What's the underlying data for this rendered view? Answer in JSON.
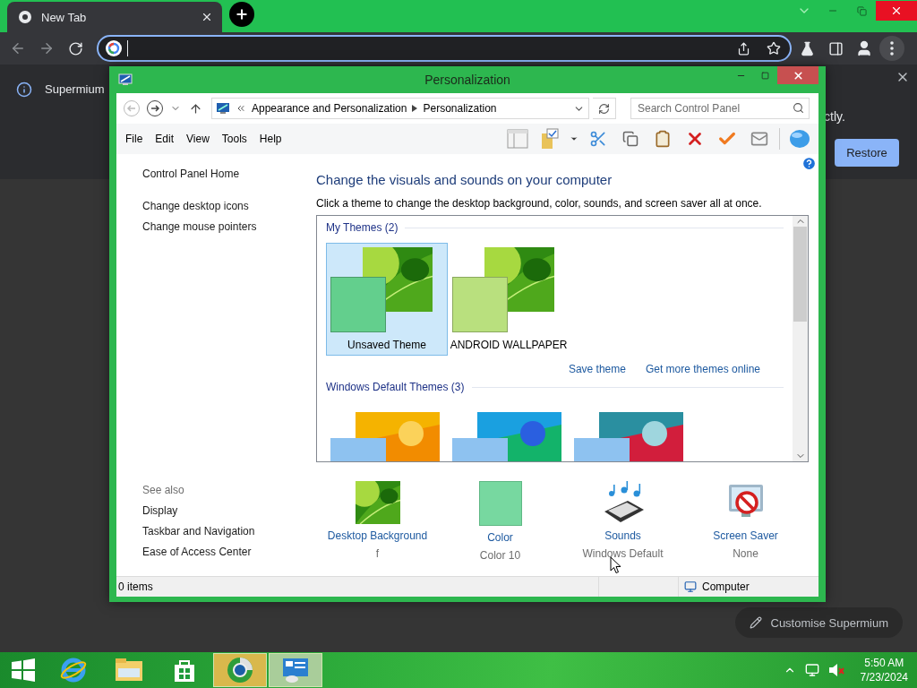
{
  "browser": {
    "tab": {
      "title": "New Tab"
    },
    "omnibox": {
      "focused": true
    },
    "infobar": {
      "title": "Supermium",
      "message": "ctly.",
      "button": "Restore"
    },
    "customise_button": "Customise Supermium"
  },
  "window": {
    "title": "Personalization",
    "breadcrumb": [
      "Appearance and Personalization",
      "Personalization"
    ],
    "search": {
      "placeholder": "Search Control Panel"
    },
    "menu": [
      "File",
      "Edit",
      "View",
      "Tools",
      "Help"
    ],
    "sidebar": {
      "links": [
        "Control Panel Home",
        "Change desktop icons",
        "Change mouse pointers"
      ],
      "see_also_title": "See also",
      "see_also": [
        "Display",
        "Taskbar and Navigation",
        "Ease of Access Center"
      ]
    },
    "heading": "Change the visuals and sounds on your computer",
    "subtitle": "Click a theme to change the desktop background, color, sounds, and screen saver all at once.",
    "theme_groups": [
      {
        "title": "My Themes (2)",
        "themes": [
          {
            "name": "Unsaved Theme",
            "selected": true,
            "color": "#63cf8d"
          },
          {
            "name": "ANDROID WALLPAPER",
            "selected": false,
            "color": "#b9e07e"
          }
        ],
        "links": [
          "Save theme",
          "Get more themes online"
        ]
      },
      {
        "title": "Windows Default Themes (3)",
        "themes": [
          {
            "selected": false
          },
          {
            "selected": false
          },
          {
            "selected": false
          }
        ]
      }
    ],
    "settings": [
      {
        "kind": "background",
        "label": "Desktop Background",
        "value": "f"
      },
      {
        "kind": "color",
        "label": "Color",
        "value": "Color 10"
      },
      {
        "kind": "sounds",
        "label": "Sounds",
        "value": "Windows Default"
      },
      {
        "kind": "screensaver",
        "label": "Screen Saver",
        "value": "None"
      }
    ],
    "status_bar": {
      "items": "0 items",
      "location": "Computer"
    }
  },
  "taskbar": {
    "apps": [
      {
        "kind": "ie",
        "active": false
      },
      {
        "kind": "explorer",
        "active": false
      },
      {
        "kind": "store",
        "active": false
      },
      {
        "kind": "chrome",
        "active": true
      },
      {
        "kind": "control",
        "active": true
      }
    ],
    "clock": {
      "time": "5:50 AM",
      "date": "7/23/2024"
    }
  }
}
